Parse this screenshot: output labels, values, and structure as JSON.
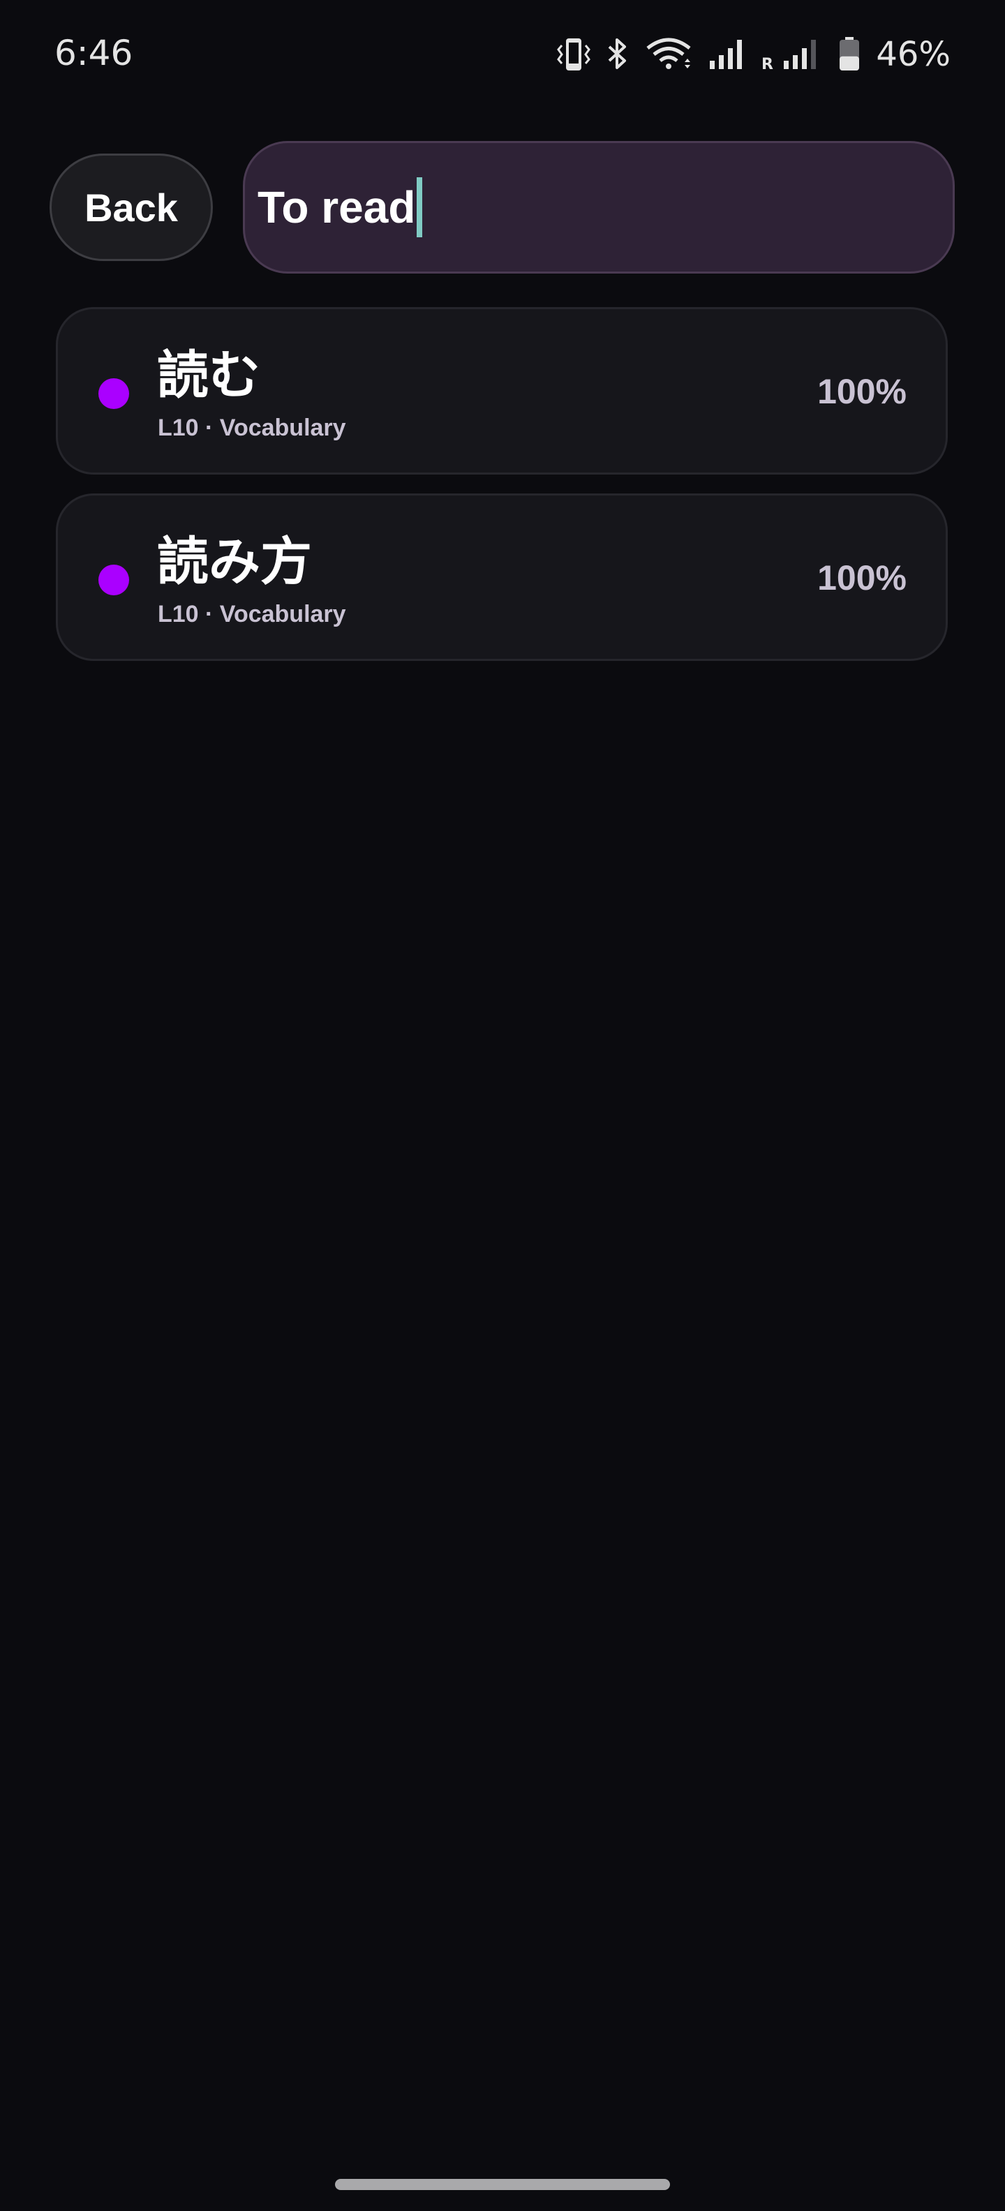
{
  "status_bar": {
    "time": "6:46",
    "battery_percent": "46%",
    "battery_level": 0.46,
    "icons": [
      "vibrate-icon",
      "bluetooth-icon",
      "wifi-icon",
      "signal-icon",
      "roaming-signal-icon",
      "battery-icon"
    ],
    "roaming_label": "R"
  },
  "header": {
    "back_label": "Back",
    "search_value": "To read"
  },
  "results": [
    {
      "word": "読む",
      "meta": "L10 · Vocabulary",
      "percent": "100%",
      "dot_color": "#aa00ff"
    },
    {
      "word": "読み方",
      "meta": "L10 · Vocabulary",
      "percent": "100%",
      "dot_color": "#aa00ff"
    }
  ],
  "colors": {
    "background": "#0b0b0f",
    "accent": "#aa00ff",
    "caret": "#80cbc4",
    "search_bg": "#2e2236"
  }
}
